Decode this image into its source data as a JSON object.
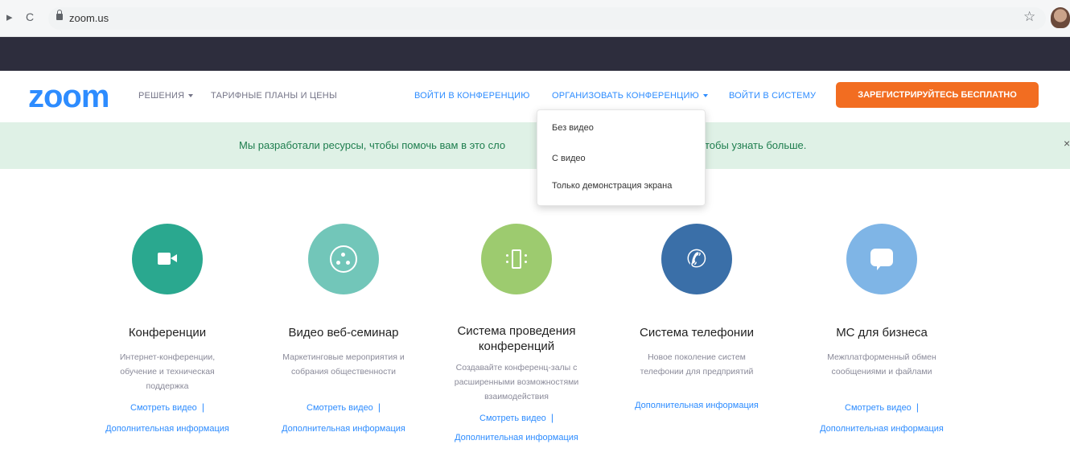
{
  "browser": {
    "back_glyph": "▸",
    "reload_glyph": "C",
    "url": "zoom.us",
    "star_glyph": "☆"
  },
  "header": {
    "logo": "zoom",
    "nav": {
      "solutions": "РЕШЕНИЯ",
      "plans": "ТАРИФНЫЕ ПЛАНЫ И ЦЕНЫ",
      "join": "ВОЙТИ В КОНФЕРЕНЦИЮ",
      "host": "ОРГАНИЗОВАТЬ КОНФЕРЕНЦИЮ",
      "signin": "ВОЙТИ В СИСТЕМУ",
      "signup": "ЗАРЕГИСТРИРУЙТЕСЬ БЕСПЛАТНО"
    }
  },
  "banner": {
    "left_text": "Мы разработали ресурсы, чтобы помочь вам в это сло",
    "right_text": "тобы узнать больше.",
    "close": "×"
  },
  "dropdown": {
    "items": [
      "Без видео",
      "С видео",
      "Только демонстрация экрана"
    ]
  },
  "products": [
    {
      "title": "Конференции",
      "desc": [
        "Интернет-конференции,",
        "обучение и техническая",
        "поддержка"
      ],
      "link_video": "Смотреть видео",
      "separator": "|",
      "link_info": "Дополнительная информация",
      "color": "#2aa88f"
    },
    {
      "title": "Видео веб-семинар",
      "desc": [
        "Маркетинговые мероприятия и",
        "собрания общественности"
      ],
      "link_video": "Смотреть видео",
      "separator": "|",
      "link_info": "Дополнительная информация",
      "color": "#72c6b9"
    },
    {
      "title": [
        "Система проведения",
        "конференций"
      ],
      "desc": [
        "Создавайте конференц-залы с",
        "расширенными возможностями",
        "взаимодействия"
      ],
      "link_video": "Смотреть видео",
      "separator": "|",
      "link_info": "Дополнительная информация",
      "color": "#9dcb6f"
    },
    {
      "title": "Система телефонии",
      "desc": [
        "Новое поколение систем",
        "телефонии для предприятий"
      ],
      "link_info": "Дополнительная информация",
      "phone_glyph": "✆",
      "color": "#3a6fa8"
    },
    {
      "title": "МС для бизнеса",
      "desc": [
        "Межплатформенный обмен",
        "сообщениями и файлами"
      ],
      "link_video": "Смотреть видео",
      "separator": "|",
      "link_info": "Дополнительная информация",
      "color": "#7fb5e6"
    }
  ]
}
